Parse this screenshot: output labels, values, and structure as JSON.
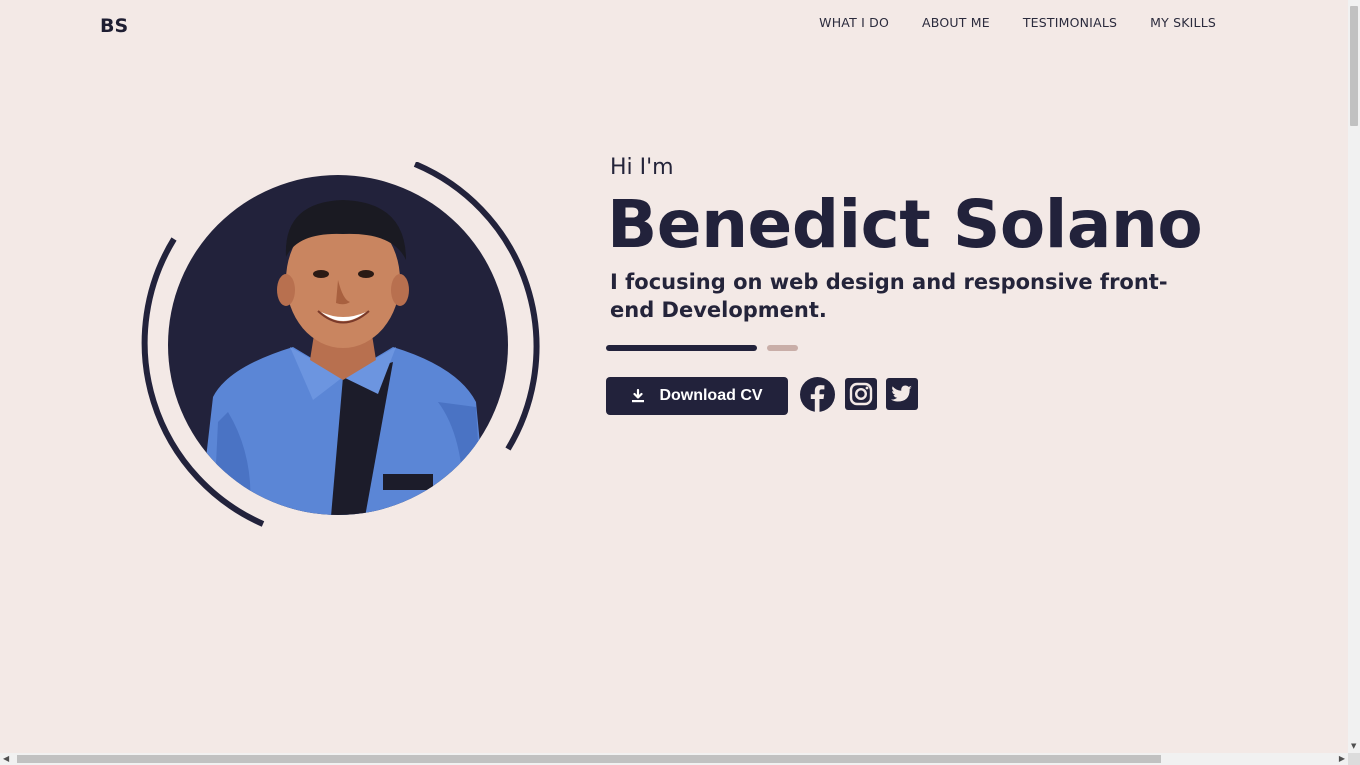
{
  "nav": {
    "logo": "BS",
    "links": [
      "WHAT I DO",
      "ABOUT ME",
      "TESTIMONIALS",
      "MY SKILLS"
    ]
  },
  "hero": {
    "greeting": "Hi I'm",
    "name": "Benedict Solano",
    "tagline": "I focusing on web design and responsive front-end Development.",
    "download_label": "Download CV",
    "social_icons": [
      "facebook-icon",
      "instagram-icon",
      "twitter-icon"
    ]
  },
  "colors": {
    "background": "#f3e9e6",
    "primary": "#22223b",
    "accent": "#c9aea8",
    "shirt": "#5b86d6"
  }
}
